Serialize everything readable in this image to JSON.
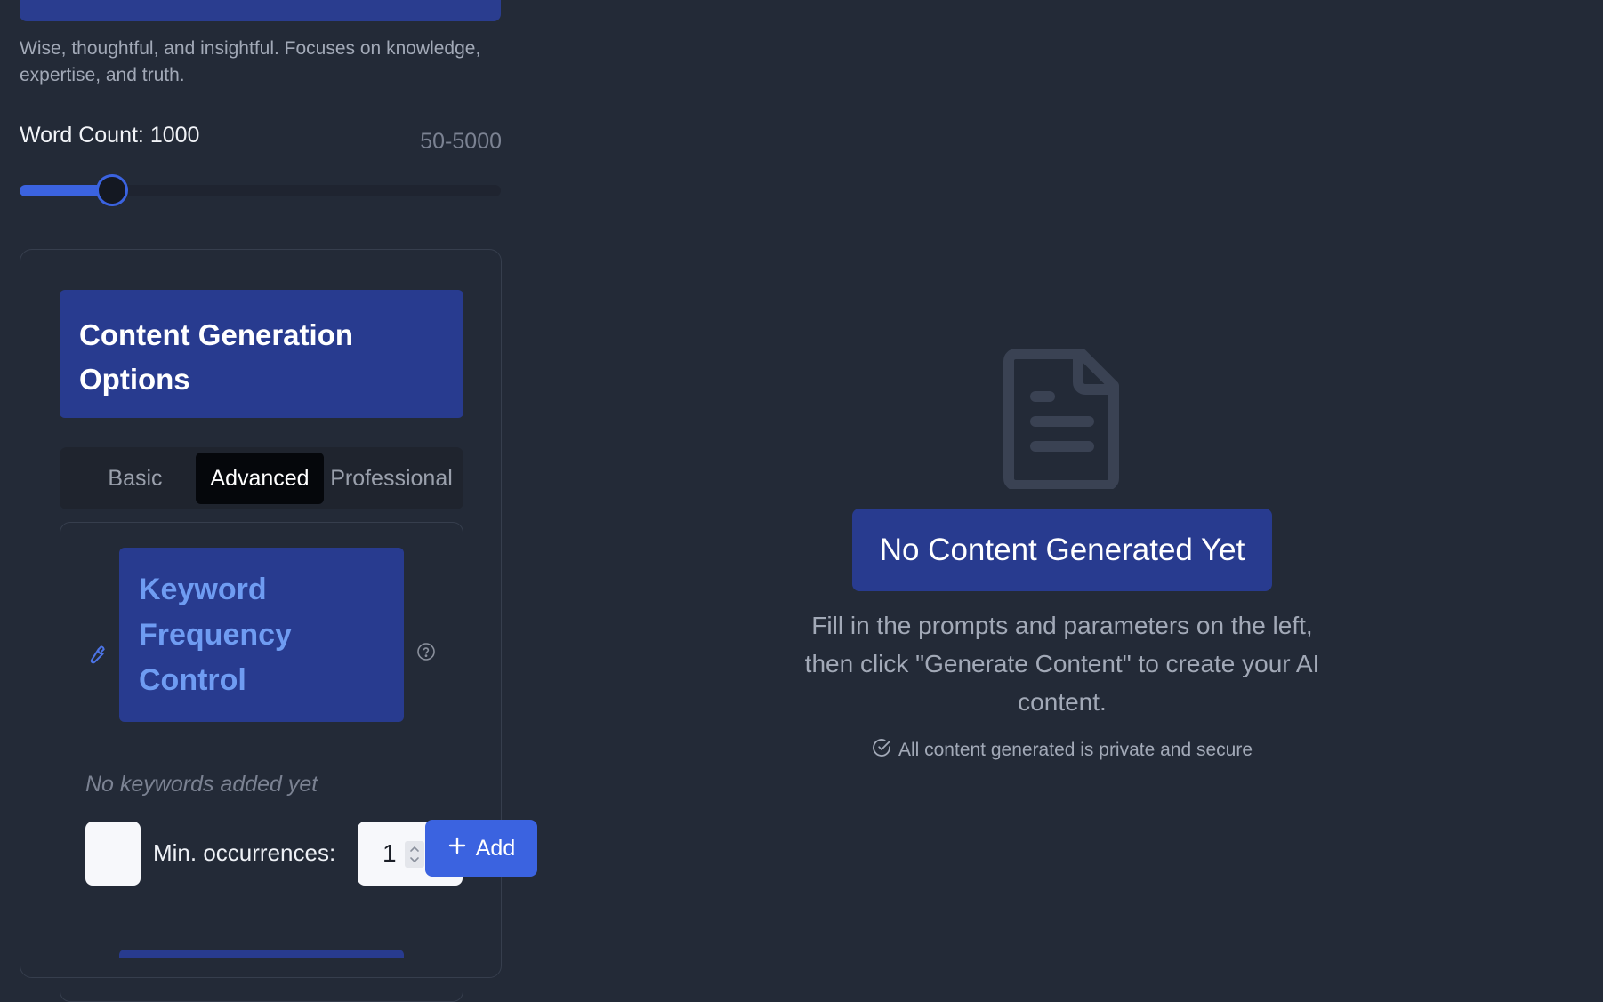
{
  "persona": {
    "description": "Wise, thoughtful, and insightful. Focuses on knowledge, expertise, and truth."
  },
  "word_count": {
    "label": "Word Count: 1000",
    "range": "50-5000",
    "value": 1000,
    "min": 50,
    "max": 5000
  },
  "options": {
    "title": "Content Generation Options",
    "tabs": [
      {
        "label": "Basic",
        "active": false
      },
      {
        "label": "Advanced",
        "active": true
      },
      {
        "label": "Professional",
        "active": false
      }
    ]
  },
  "keyword_control": {
    "title": "Keyword Frequency Control",
    "empty_text": "No keywords added yet",
    "keyword_value": "",
    "min_occurrences_label": "Min. occurrences:",
    "min_occurrences_value": "1",
    "add_label": "Add"
  },
  "empty_state": {
    "title": "No Content Generated Yet",
    "description": "Fill in the prompts and parameters on the left, then click \"Generate Content\" to create your AI content.",
    "secure_note": "All content generated is private and secure",
    "icon": "document-icon"
  },
  "colors": {
    "background": "#232a37",
    "accent": "#3b63e0",
    "title_block": "#283b8f",
    "keyword_title_text": "#6f9cf2"
  }
}
